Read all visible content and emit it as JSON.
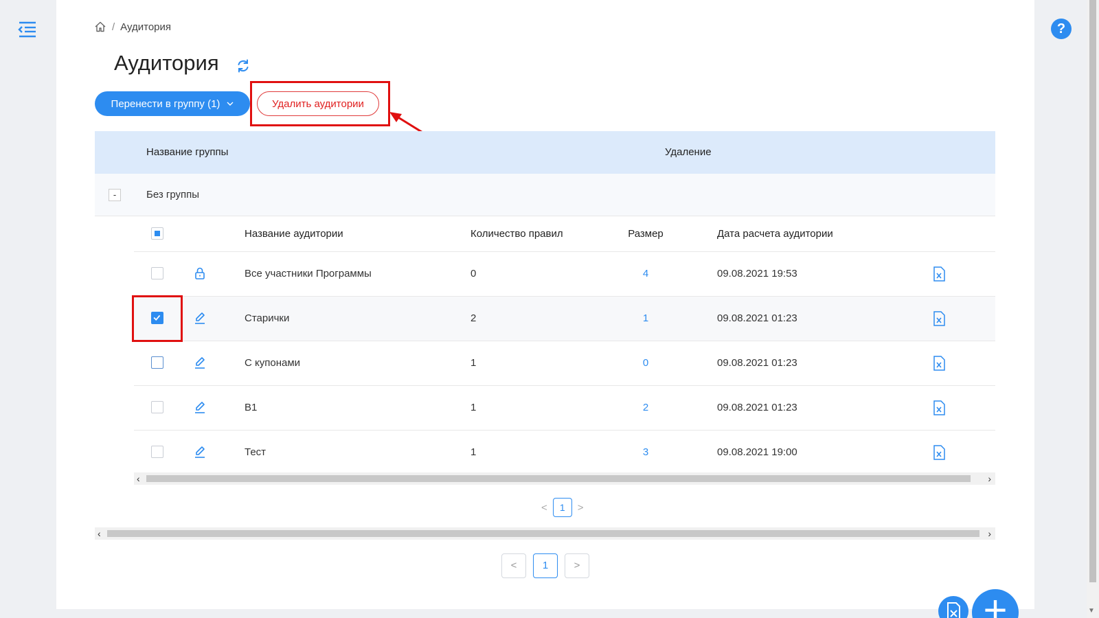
{
  "breadcrumb": {
    "current": "Аудитория",
    "separator": "/"
  },
  "page": {
    "title": "Аудитория"
  },
  "toolbar": {
    "move_label": "Перенести в группу (1)",
    "delete_label": "Удалить аудитории"
  },
  "group_table": {
    "col_group": "Название группы",
    "col_delete": "Удаление",
    "group": {
      "toggle": "-",
      "name": "Без группы"
    }
  },
  "audience_table": {
    "headers": {
      "name": "Название аудитории",
      "rules": "Количество правил",
      "size": "Размер",
      "date": "Дата расчета аудитории"
    },
    "rows": [
      {
        "name": "Все участники Программы",
        "rules": "0",
        "size": "4",
        "date": "09.08.2021 19:53",
        "checked": false,
        "action_icon": "lock-icon"
      },
      {
        "name": "Старички",
        "rules": "2",
        "size": "1",
        "date": "09.08.2021 01:23",
        "checked": true,
        "action_icon": "edit-icon"
      },
      {
        "name": "С купонами",
        "rules": "1",
        "size": "0",
        "date": "09.08.2021 01:23",
        "checked": false,
        "action_icon": "edit-icon"
      },
      {
        "name": "В1",
        "rules": "1",
        "size": "2",
        "date": "09.08.2021 01:23",
        "checked": false,
        "action_icon": "edit-icon"
      },
      {
        "name": "Тест",
        "rules": "1",
        "size": "3",
        "date": "09.08.2021 19:00",
        "checked": false,
        "action_icon": "edit-icon"
      }
    ]
  },
  "pagination": {
    "inner_page": "1",
    "outer_page": "1",
    "prev": "<",
    "next": ">"
  },
  "help": {
    "label": "?"
  },
  "fab": {
    "add_label": "+"
  },
  "colors": {
    "accent": "#2d8cf0",
    "highlight": "#e01010",
    "header_bg": "#dceafb"
  }
}
